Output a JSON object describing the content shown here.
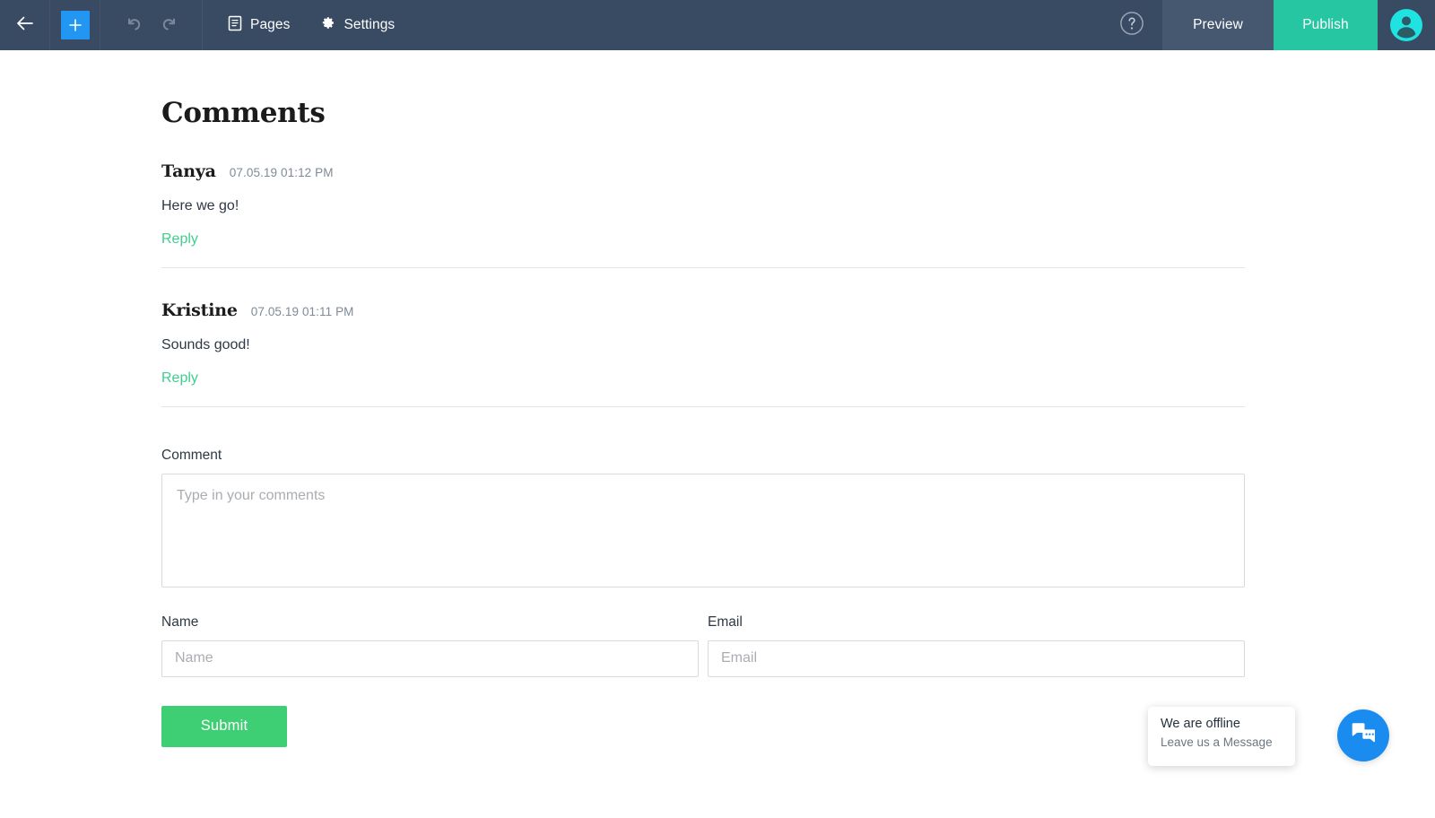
{
  "toolbar": {
    "back_icon": "arrow-left-icon",
    "add_icon": "plus-icon",
    "undo_icon": "undo-arrow-icon",
    "redo_icon": "redo-arrow-icon",
    "items": [
      {
        "label": "Pages",
        "icon": "page-document-icon"
      },
      {
        "label": "Settings",
        "icon": "gear-icon"
      }
    ],
    "help_icon": "question-circle-icon",
    "preview_label": "Preview",
    "publish_label": "Publish",
    "avatar_icon": "user-avatar-icon",
    "colors": {
      "bar_bg": "#394a63",
      "add_blue": "#2196f3",
      "preview_bg": "#455870",
      "publish_bg": "#26c6a2",
      "avatar_bg": "#1fe3e0"
    }
  },
  "page": {
    "title": "Comments"
  },
  "comments": [
    {
      "author": "Tanya",
      "date": "07.05.19 01:12 PM",
      "body": "Here we go!",
      "reply_label": "Reply"
    },
    {
      "author": "Kristine",
      "date": "07.05.19 01:11 PM",
      "body": "Sounds good!",
      "reply_label": "Reply"
    }
  ],
  "form": {
    "comment_label": "Comment",
    "comment_placeholder": "Type in your comments",
    "comment_value": "",
    "name_label": "Name",
    "name_placeholder": "Name",
    "name_value": "",
    "email_label": "Email",
    "email_placeholder": "Email",
    "email_value": "",
    "submit_label": "Submit",
    "submit_color": "#3ecf75",
    "reply_link_color": "#3ecf8e"
  },
  "chat_widget": {
    "title": "We are offline",
    "subtitle": "Leave us a Message",
    "button_icon": "chat-bubbles-icon",
    "button_color": "#1a8cf0"
  }
}
